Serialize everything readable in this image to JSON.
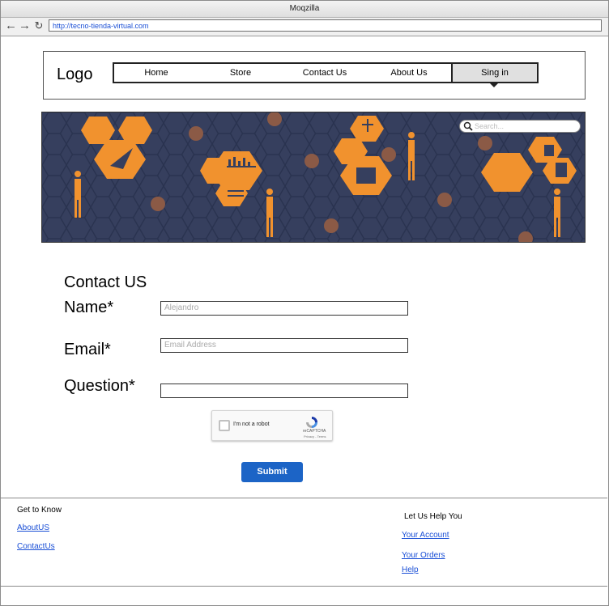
{
  "browser": {
    "title": "Moqzilla",
    "url": "http://tecno-tienda-virtual.com"
  },
  "header": {
    "logo": "Logo",
    "nav": [
      "Home",
      "Store",
      "Contact Us",
      "About Us",
      "Sing in"
    ]
  },
  "search": {
    "placeholder": "Search..."
  },
  "form": {
    "title": "Contact US",
    "name_label": "Name*",
    "name_value": "Alejandro",
    "email_label": "Email*",
    "email_placeholder": "Email Address",
    "question_label": "Question*",
    "question_value": "",
    "captcha_text": "I'm not a robot",
    "captcha_brand": "reCAPTCHA",
    "captcha_links": "Privacy - Terms",
    "submit_label": "Submit"
  },
  "footer": {
    "col1": {
      "heading": "Get to Know",
      "links": [
        "AboutUS",
        "ContactUs"
      ]
    },
    "col2": {
      "heading": "Let Us Help You",
      "links": [
        "Your Account",
        "Your Orders",
        "Help"
      ]
    }
  },
  "colors": {
    "accent": "#f1922e",
    "banner_bg": "#363f5e",
    "submit": "#1c64c6"
  }
}
